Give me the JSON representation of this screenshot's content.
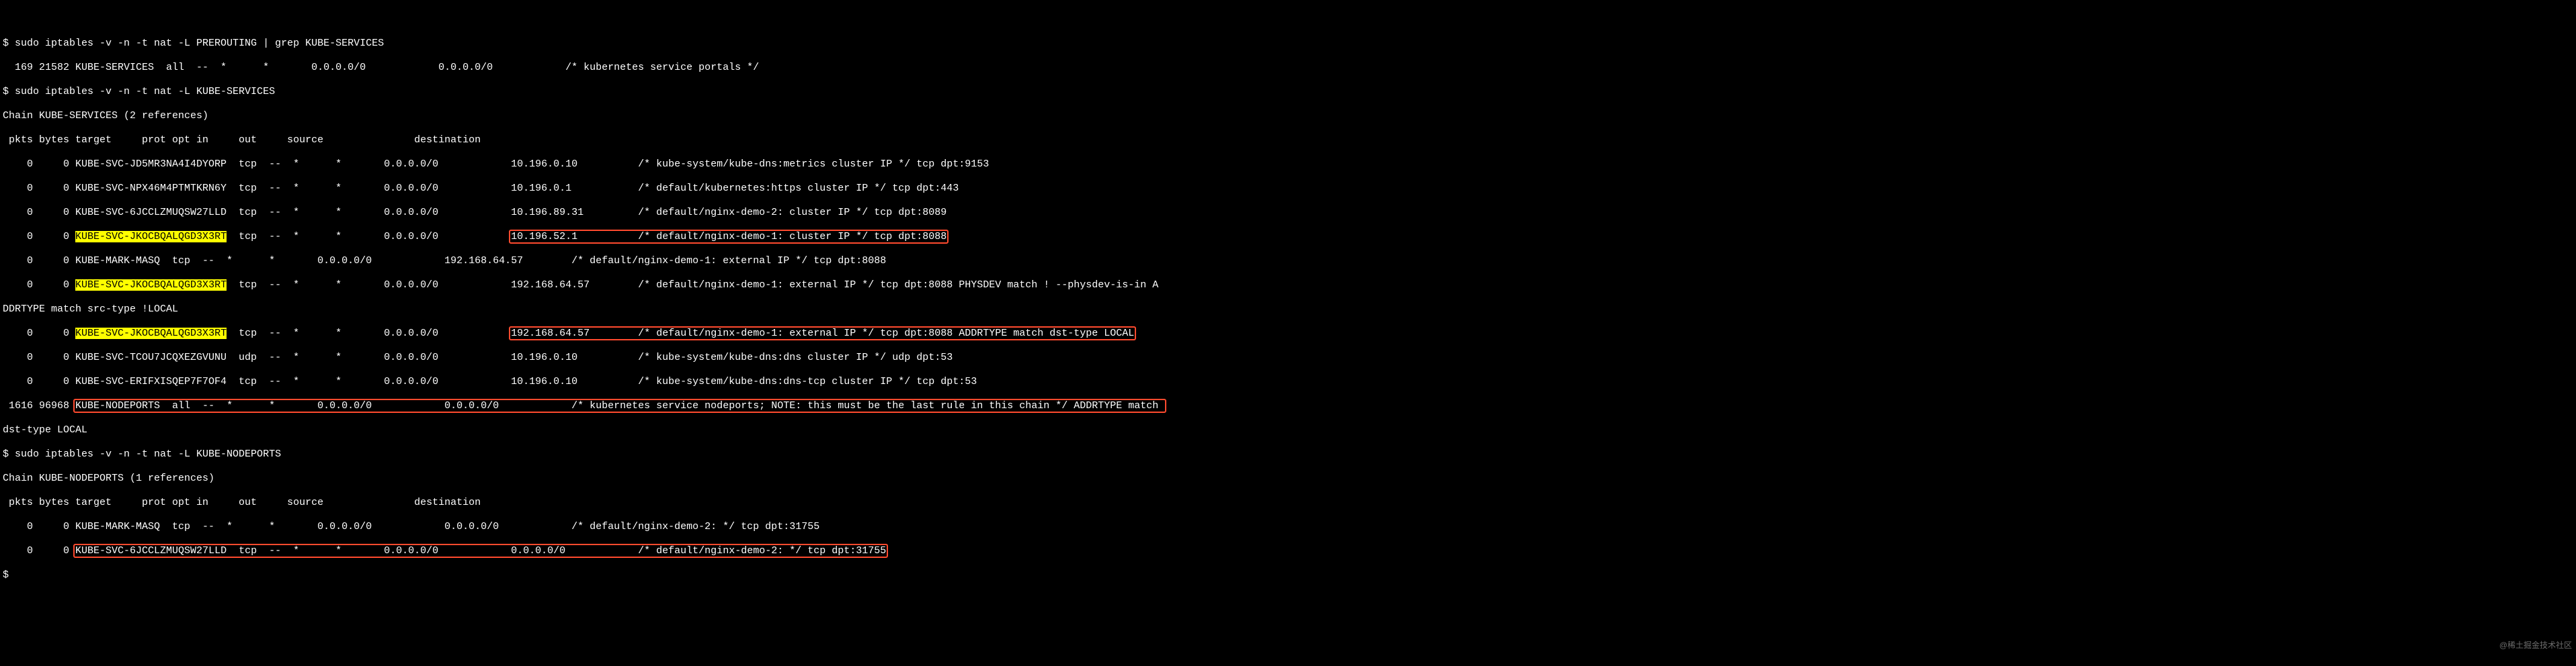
{
  "l1": "$ sudo iptables -v -n -t nat -L PREROUTING | grep KUBE-SERVICES",
  "l2": "  169 21582 KUBE-SERVICES  all  --  *      *       0.0.0.0/0            0.0.0.0/0            /* kubernetes service portals */",
  "l3": "$ sudo iptables -v -n -t nat -L KUBE-SERVICES",
  "l4": "Chain KUBE-SERVICES (2 references)",
  "l5": " pkts bytes target     prot opt in     out     source               destination",
  "l6": "    0     0 KUBE-SVC-JD5MR3NA4I4DYORP  tcp  --  *      *       0.0.0.0/0            10.196.0.10          /* kube-system/kube-dns:metrics cluster IP */ tcp dpt:9153",
  "l7": "    0     0 KUBE-SVC-NPX46M4PTMTKRN6Y  tcp  --  *      *       0.0.0.0/0            10.196.0.1           /* default/kubernetes:https cluster IP */ tcp dpt:443",
  "l8": "    0     0 KUBE-SVC-6JCCLZMUQSW27LLD  tcp  --  *      *       0.0.0.0/0            10.196.89.31         /* default/nginx-demo-2: cluster IP */ tcp dpt:8089",
  "l9a": "    0     0 ",
  "l9b": "KUBE-SVC-JKOCBQALQGD3X3RT",
  "l9c": "  tcp  --  *      *       0.0.0.0/0            ",
  "l9d": "10.196.52.1          /* default/nginx-demo-1: cluster IP */ tcp dpt:8088",
  "l10": "    0     0 KUBE-MARK-MASQ  tcp  --  *      *       0.0.0.0/0            192.168.64.57        /* default/nginx-demo-1: external IP */ tcp dpt:8088",
  "l11a": "    0     0 ",
  "l11b": "KUBE-SVC-JKOCBQALQGD3X3RT",
  "l11c": "  tcp  --  *      *       0.0.0.0/0            192.168.64.57        /* default/nginx-demo-1: external IP */ tcp dpt:8088 PHYSDEV match ! --physdev-is-in A",
  "l12": "DDRTYPE match src-type !LOCAL",
  "l13a": "    0     0 ",
  "l13b": "KUBE-SVC-JKOCBQALQGD3X3RT",
  "l13c": "  tcp  --  *      *       0.0.0.0/0            ",
  "l13d": "192.168.64.57        /* default/nginx-demo-1: external IP */ tcp dpt:8088 ADDRTYPE match dst-type LOCAL",
  "l14": "    0     0 KUBE-SVC-TCOU7JCQXEZGVUNU  udp  --  *      *       0.0.0.0/0            10.196.0.10          /* kube-system/kube-dns:dns cluster IP */ udp dpt:53",
  "l15": "    0     0 KUBE-SVC-ERIFXISQEP7F7OF4  tcp  --  *      *       0.0.0.0/0            10.196.0.10          /* kube-system/kube-dns:dns-tcp cluster IP */ tcp dpt:53",
  "l16a": " 1616 96968 ",
  "l16b": "KUBE-NODEPORTS  all  --  *      *       0.0.0.0/0            0.0.0.0/0            /* kubernetes service nodeports; NOTE: this must be the last rule in this chain */ ADDRTYPE match ",
  "l17": "dst-type LOCAL",
  "l18": "$ sudo iptables -v -n -t nat -L KUBE-NODEPORTS",
  "l19": "Chain KUBE-NODEPORTS (1 references)",
  "l20": " pkts bytes target     prot opt in     out     source               destination",
  "l21": "    0     0 KUBE-MARK-MASQ  tcp  --  *      *       0.0.0.0/0            0.0.0.0/0            /* default/nginx-demo-2: */ tcp dpt:31755",
  "l22a": "    0     0 ",
  "l22b": "KUBE-SVC-6JCCLZMUQSW27LLD  tcp  --  *      *       0.0.0.0/0            0.0.0.0/0            /* default/nginx-demo-2: */ tcp dpt:31755",
  "l23": "$ ",
  "wm": "@稀土掘金技术社区"
}
